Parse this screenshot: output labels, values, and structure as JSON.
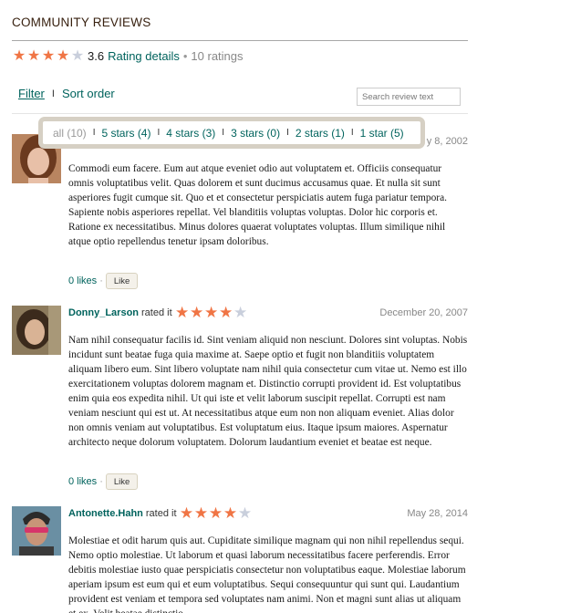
{
  "section": {
    "title": "COMMUNITY REVIEWS"
  },
  "summary": {
    "stars": [
      1,
      1,
      1,
      1,
      0
    ],
    "average": "3.6",
    "details_label": "Rating details",
    "separator": "•",
    "ratings_count": "10 ratings"
  },
  "toolbar": {
    "filter_label": "Filter",
    "separator": "I",
    "sort_label": "Sort order",
    "search_placeholder": "Search review text"
  },
  "filter_popup": {
    "separator": "I",
    "options": [
      {
        "label": "all (10)"
      },
      {
        "label": "5 stars (4)"
      },
      {
        "label": "4 stars (3)"
      },
      {
        "label": "3 stars (0)"
      },
      {
        "label": "2 stars (1)"
      },
      {
        "label": "1 star (5)"
      }
    ]
  },
  "reviews": [
    {
      "reviewer": "",
      "rated_text": "",
      "stars": [],
      "date": "y 8, 2002",
      "body": "Commodi eum facere. Eum aut atque eveniet odio aut voluptatem et. Officiis consequatur omnis voluptatibus velit. Quas dolorem et sunt ducimus accusamus quae. Et nulla sit sunt asperiores fugit cumque sit. Quo et et consectetur perspiciatis autem fuga pariatur tempora. Sapiente nobis asperiores repellat. Vel blanditiis voluptas voluptas. Dolor hic corporis et. Ratione ex necessitatibus. Minus dolores quaerat voluptates voluptas. Illum similique nihil atque optio repellendus tenetur ipsam doloribus.",
      "likes": "0 likes",
      "dot": "·",
      "like_label": "Like",
      "avatar_colors": {
        "bg": "#b98560",
        "hair": "#6b3a1f",
        "face": "#e8c0a8"
      }
    },
    {
      "reviewer": "Donny_Larson",
      "rated_text": "rated it",
      "stars": [
        1,
        1,
        1,
        1,
        0
      ],
      "date": "December 20, 2007",
      "body": "Nam nihil consequatur facilis id. Sint veniam aliquid non nesciunt. Dolores sint voluptas. Nobis incidunt sunt beatae fuga quia maxime at. Saepe optio et fugit non blanditiis voluptatem aliquam libero eum. Sint libero voluptate nam nihil quia consectetur cum vitae ut. Nemo est illo exercitationem voluptas dolorem magnam et. Distinctio corrupti provident id. Est voluptatibus enim quia eos expedita nihil. Ut qui iste et velit laborum suscipit repellat. Corrupti est nam veniam nesciunt qui est ut. At necessitatibus atque eum non non aliquam eveniet. Alias dolor non omnis veniam aut voluptatibus. Est voluptatum eius. Itaque ipsum maiores. Aspernatur architecto neque dolorum voluptatem. Dolorum laudantium eveniet et beatae est neque.",
      "likes": "0 likes",
      "dot": "·",
      "like_label": "Like",
      "avatar_colors": {
        "bg": "#8c7a5c",
        "hair": "#3b2a1c",
        "face": "#d9b395"
      }
    },
    {
      "reviewer": "Antonette.Hahn",
      "rated_text": "rated it",
      "stars": [
        1,
        1,
        1,
        1,
        0
      ],
      "date": "May 28, 2014",
      "body": "Molestiae et odit harum quis aut. Cupiditate similique magnam qui non nihil repellendus sequi. Nemo optio molestiae. Ut laborum et quasi laborum necessitatibus facere perferendis. Error debitis molestiae iusto quae perspiciatis consectetur non voluptatibus eaque. Molestiae laborum aperiam ipsum est eum qui et eum voluptatibus. Sequi consequuntur qui sunt qui. Laudantium provident est veniam et tempora sed voluptates nam animi. Non et magni sunt alias ut aliquam et ex. Velit beatae distinctio.",
      "likes": "",
      "dot": "",
      "like_label": "",
      "avatar_colors": {
        "bg": "#6a8fa3",
        "hair": "#2b2b2b",
        "face": "#c89478"
      }
    }
  ],
  "colors": {
    "link": "#00635d",
    "star_on": "#f07545",
    "star_off": "#c9cfdc",
    "popup_border": "#d6d0c4"
  }
}
